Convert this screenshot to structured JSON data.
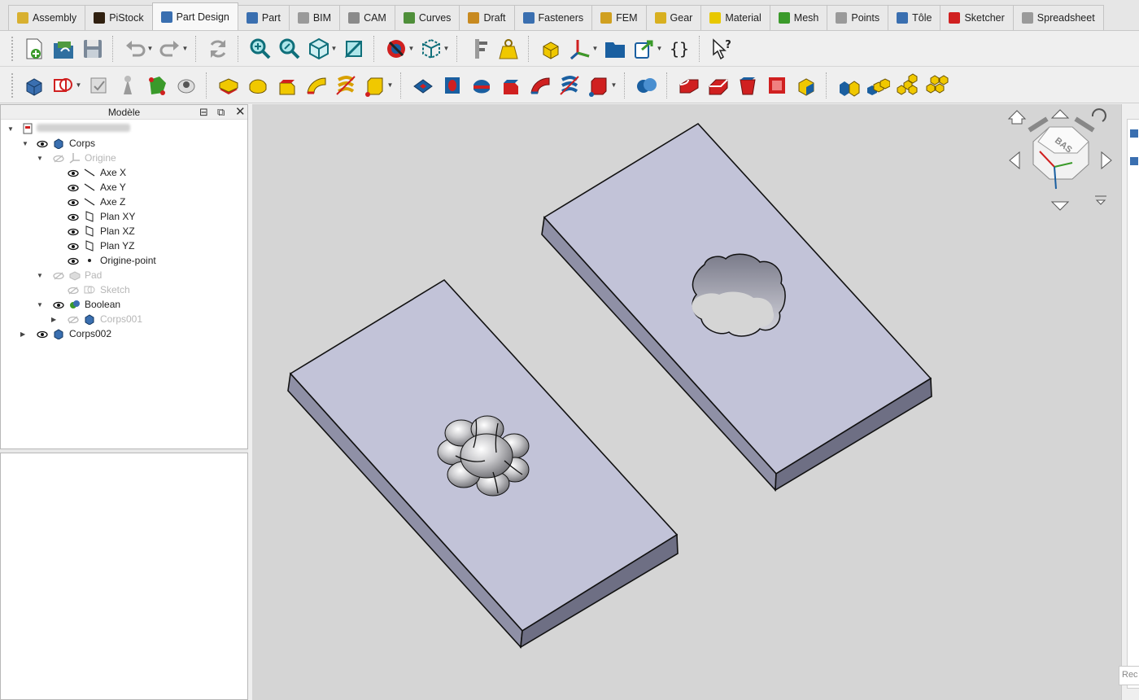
{
  "workbench_tabs": [
    {
      "label": "Assembly",
      "icon": "assembly-icon",
      "color": "#d8b030",
      "active": false
    },
    {
      "label": "PiStock",
      "icon": "pistock-icon",
      "color": "#302010",
      "active": false
    },
    {
      "label": "Part Design",
      "icon": "part-design-icon",
      "color": "#3a6fb0",
      "active": true
    },
    {
      "label": "Part",
      "icon": "part-icon",
      "color": "#3a6fb0",
      "active": false
    },
    {
      "label": "BIM",
      "icon": "bim-icon",
      "color": "#9a9a9a",
      "active": false
    },
    {
      "label": "CAM",
      "icon": "cam-icon",
      "color": "#8a8a8a",
      "active": false
    },
    {
      "label": "Curves",
      "icon": "curves-icon",
      "color": "#4f8f3a",
      "active": false
    },
    {
      "label": "Draft",
      "icon": "draft-icon",
      "color": "#c88a20",
      "active": false
    },
    {
      "label": "Fasteners",
      "icon": "fasteners-icon",
      "color": "#3a6fb0",
      "active": false
    },
    {
      "label": "FEM",
      "icon": "fem-icon",
      "color": "#d0a020",
      "active": false
    },
    {
      "label": "Gear",
      "icon": "gear-icon",
      "color": "#d8b020",
      "active": false
    },
    {
      "label": "Material",
      "icon": "material-icon",
      "color": "#e8c800",
      "active": false
    },
    {
      "label": "Mesh",
      "icon": "mesh-icon",
      "color": "#3a9a2a",
      "active": false
    },
    {
      "label": "Points",
      "icon": "points-icon",
      "color": "#9a9a9a",
      "active": false
    },
    {
      "label": "Tôle",
      "icon": "sheetmetal-icon",
      "color": "#3a6fb0",
      "active": false
    },
    {
      "label": "Sketcher",
      "icon": "sketcher-icon",
      "color": "#d02020",
      "active": false
    },
    {
      "label": "Spreadsheet",
      "icon": "spreadsheet-icon",
      "color": "#9a9a9a",
      "active": false
    }
  ],
  "combo_view": {
    "title": "Modèle",
    "tree": [
      {
        "label": "",
        "icon": "document-icon",
        "blurred": true,
        "eye": "none",
        "dim": false
      },
      {
        "label": "Corps",
        "icon": "body-icon",
        "eye": "visible",
        "dim": false
      },
      {
        "label": "Origine",
        "icon": "origin-icon",
        "eye": "hidden",
        "dim": true
      },
      {
        "label": "Axe X",
        "icon": "axis-icon",
        "eye": "visible",
        "dim": false
      },
      {
        "label": "Axe Y",
        "icon": "axis-icon",
        "eye": "visible",
        "dim": false
      },
      {
        "label": "Axe Z",
        "icon": "axis-icon",
        "eye": "visible",
        "dim": false
      },
      {
        "label": "Plan XY",
        "icon": "plane-icon",
        "eye": "visible",
        "dim": false
      },
      {
        "label": "Plan XZ",
        "icon": "plane-icon",
        "eye": "visible",
        "dim": false
      },
      {
        "label": "Plan YZ",
        "icon": "plane-icon",
        "eye": "visible",
        "dim": false
      },
      {
        "label": "Origine-point",
        "icon": "point-icon",
        "eye": "visible",
        "dim": false
      },
      {
        "label": "Pad",
        "icon": "pad-icon",
        "eye": "hidden",
        "dim": true
      },
      {
        "label": "Sketch",
        "icon": "sketch-icon",
        "eye": "hidden",
        "dim": true
      },
      {
        "label": "Boolean",
        "icon": "boolean-icon",
        "eye": "visible",
        "dim": false
      },
      {
        "label": "Corps001",
        "icon": "body-icon",
        "eye": "hidden",
        "dim": true
      },
      {
        "label": "Corps002",
        "icon": "body-icon",
        "eye": "visible",
        "dim": false
      }
    ]
  },
  "navigation_cube": {
    "face_label": "BAS"
  },
  "report_input": {
    "placeholder": "Rec"
  },
  "colors": {
    "view_background": "#d5d5d5",
    "plate_top": "#c2c3d8",
    "plate_side": "#8f90a6",
    "plate_front": "#6e6f84",
    "accent_blue": "#3a6fb0",
    "accent_yellow": "#f0c800",
    "accent_red": "#d02020"
  }
}
